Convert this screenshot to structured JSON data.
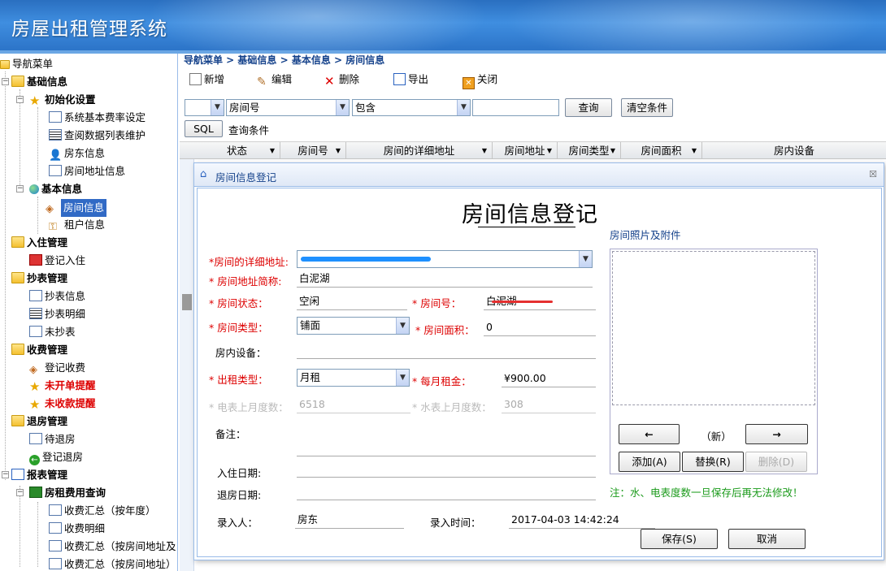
{
  "app": {
    "title": "房屋出租管理系统"
  },
  "nav": {
    "items": [
      {
        "label": "导航菜单"
      },
      {
        "label": "基础信息"
      },
      {
        "label": "初始化设置"
      },
      {
        "label": "系统基本费率设定"
      },
      {
        "label": "查阅数据列表维护"
      },
      {
        "label": "房东信息"
      },
      {
        "label": "房间地址信息"
      },
      {
        "label": "基本信息"
      },
      {
        "label": "房间信息"
      },
      {
        "label": "租户信息"
      },
      {
        "label": "入住管理"
      },
      {
        "label": "登记入住"
      },
      {
        "label": "抄表管理"
      },
      {
        "label": "抄表信息"
      },
      {
        "label": "抄表明细"
      },
      {
        "label": "未抄表"
      },
      {
        "label": "收费管理"
      },
      {
        "label": "登记收费"
      },
      {
        "label": "未开单提醒"
      },
      {
        "label": "未收款提醒"
      },
      {
        "label": "退房管理"
      },
      {
        "label": "待退房"
      },
      {
        "label": "登记退房"
      },
      {
        "label": "报表管理"
      },
      {
        "label": "房租费用查询"
      },
      {
        "label": "收费汇总（按年度）"
      },
      {
        "label": "收费明细"
      },
      {
        "label": "收费汇总（按房间地址及"
      },
      {
        "label": "收费汇总（按房间地址）"
      }
    ]
  },
  "main": {
    "breadcrumb": "导航菜单 > 基础信息 > 基本信息 > 房间信息",
    "toolbar": {
      "new": "新增",
      "edit": "编辑",
      "delete": "删除",
      "export": "导出",
      "close": "关闭"
    },
    "filter": {
      "field": "房间号",
      "op": "包含",
      "value": "",
      "query": "查询",
      "clear": "清空条件",
      "sql": "SQL",
      "cond_label": "查询条件"
    },
    "columns": [
      "状态",
      "房间号",
      "房间的详细地址",
      "房间地址",
      "房间类型",
      "房间面积",
      "房内设备"
    ]
  },
  "dialog": {
    "title": "房间信息登记",
    "heading": "房间信息登记",
    "fields": {
      "address_label": "*房间的详细地址:",
      "short_label": "* 房间地址简称:",
      "short_value": "白泥湖",
      "status_label": "* 房间状态：",
      "status_value": "空闲",
      "roomno_label": "* 房间号：",
      "roomno_value": "白泥湖",
      "type_label": "* 房间类型：",
      "type_value": "铺面",
      "area_label": "* 房间面积：",
      "area_value": "0",
      "equip_label": "房内设备：",
      "renttype_label": "* 出租类型：",
      "renttype_value": "月租",
      "rent_label": "* 每月租金：",
      "rent_value": "¥900.00",
      "elec_label": "* 电表上月度数：",
      "elec_value": "6518",
      "water_label": "* 水表上月度数：",
      "water_value": "308",
      "remark_label": "备注：",
      "checkin_label": "入住日期:",
      "checkout_label": "退房日期:",
      "entry_label": "录入人：",
      "entry_value": "房东",
      "time_label": "录入时间：",
      "time_value": "2017-04-03 14:42:24"
    },
    "photos": {
      "label": "房间照片及附件",
      "prev": "←",
      "counter": "（新）",
      "next": "→",
      "add": "添加(A)",
      "replace": "替换(R)",
      "remove": "删除(D)"
    },
    "note": "注：水、电表度数一旦保存后再无法修改！",
    "save": "保存(S)",
    "cancel": "取消"
  }
}
